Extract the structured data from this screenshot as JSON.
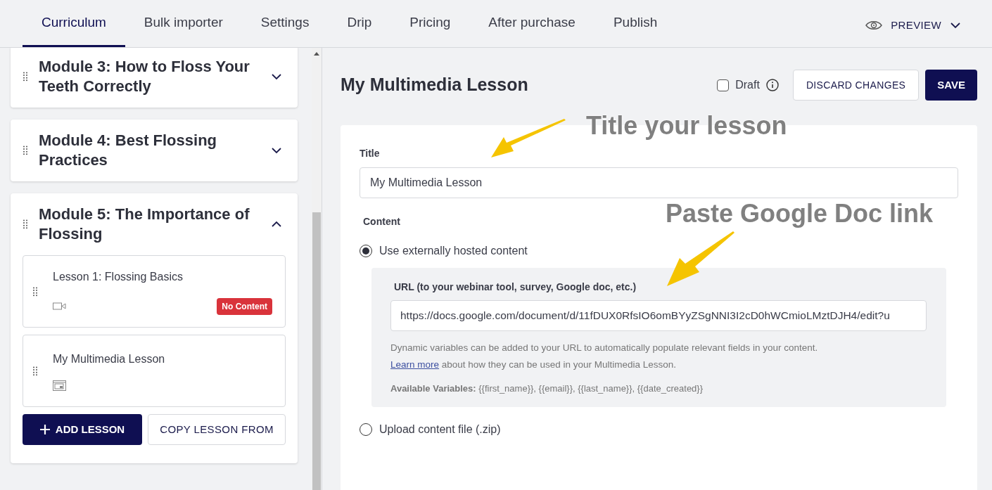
{
  "tabs": [
    {
      "label": "Curriculum",
      "selected": true
    },
    {
      "label": "Bulk importer",
      "selected": false
    },
    {
      "label": "Settings",
      "selected": false
    },
    {
      "label": "Drip",
      "selected": false
    },
    {
      "label": "Pricing",
      "selected": false
    },
    {
      "label": "After purchase",
      "selected": false
    },
    {
      "label": "Publish",
      "selected": false
    }
  ],
  "preview": {
    "label": "PREVIEW"
  },
  "modules": [
    {
      "title": "Module 3: How to Floss Your Teeth Correctly",
      "expanded": false
    },
    {
      "title": "Module 4: Best Flossing Practices",
      "expanded": false
    },
    {
      "title": "Module 5: The Importance of Flossing",
      "expanded": true,
      "lessons": [
        {
          "title": "Lesson 1: Flossing Basics",
          "kind": "video",
          "badge": "No Content"
        },
        {
          "title": "My Multimedia Lesson",
          "kind": "multimedia"
        }
      ],
      "buttons": {
        "add": "ADD LESSON",
        "copy": "COPY LESSON FROM"
      }
    }
  ],
  "editor": {
    "heading": "My Multimedia Lesson",
    "draft": {
      "label": "Draft",
      "checked": false
    },
    "discard": "DISCARD CHANGES",
    "save": "SAVE",
    "title_label": "Title",
    "title_value": "My Multimedia Lesson",
    "content_label": "Content",
    "options": [
      {
        "label": "Use externally hosted content",
        "selected": true
      },
      {
        "label": "Upload content file (.zip)",
        "selected": false
      }
    ],
    "url_label": "URL (to your webinar tool, survey, Google doc, etc.)",
    "url_value": "https://docs.google.com/document/d/11fDUX0RfsIO6omBYyZSgNNI3I2cD0hWCmioLMztDJH4/edit?u",
    "help": "Dynamic variables can be added to your URL to automatically populate relevant fields in your content.",
    "learn_more": "Learn more",
    "help2": "about how they can be used in your Multimedia Lesson.",
    "variables_label": "Available Variables:",
    "variables": "{{first_name}}, {{email}}, {{last_name}}, {{date_created}}"
  },
  "annotations": [
    "Title your lesson",
    "Paste Google Doc link"
  ]
}
